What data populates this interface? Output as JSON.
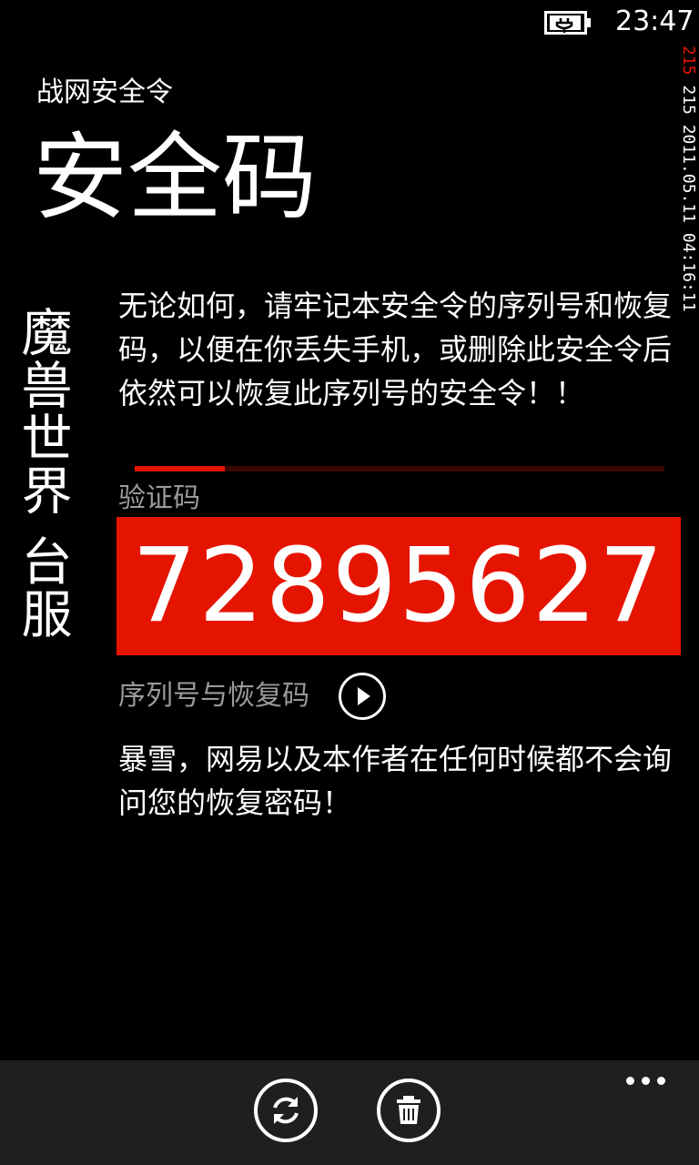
{
  "status_bar": {
    "time": "23:47",
    "battery_icon": "battery-charging-icon"
  },
  "header": {
    "app_title": "战网安全令",
    "page_title": "安全码"
  },
  "side_label": "魔兽世界 台服",
  "edge_text": {
    "red_part": "215",
    "white_part": "215 2011.05.11 04:16:11"
  },
  "main": {
    "notice": "无论如何，请牢记本安全令的序列号和恢复码，以便在你丢失手机，或删除此安全令后依然可以恢复此序列号的安全令！！",
    "progress_fraction": 0.17,
    "code_label": "验证码",
    "code_value": "72895627",
    "serial_label": "序列号与恢复码",
    "serial_icon": "play-circle-icon",
    "warning": "暴雪，网易以及本作者在任何时候都不会询问您的恢复密码！"
  },
  "app_bar": {
    "buttons": [
      {
        "icon": "sync-icon"
      },
      {
        "icon": "trash-icon"
      }
    ],
    "more_icon": "more-dots-icon"
  },
  "colors": {
    "accent": "#e51400",
    "background": "#000000",
    "app_bar": "#1f1f1f",
    "subtle_text": "#9a9a9a"
  }
}
